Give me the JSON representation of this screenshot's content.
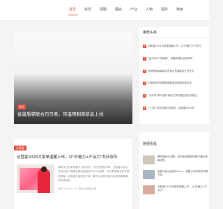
{
  "nav": {
    "items": [
      "首页",
      "资讯",
      "招聘",
      "展会",
      "产业",
      "人物",
      "国外",
      "特色"
    ]
  },
  "hero": {
    "tag": "资讯",
    "title": "雀巢盾猫联合日日煮，带温预制菜新品上线"
  },
  "article": {
    "tag": "必胜客",
    "title": "必胜客2025大菜单温暖上市，以\"价格力+产品力\"共庆双节",
    "summary": "随着今日的到来春节与发布会，不仅在餐饮市场，必胜客以全心全意加快了满满全新的经营的2025大菜单，作为美满营业给中国消费者，必胜客还将回到下单，春节以后的价格与品质惊喜美满的市场热烈。",
    "meta": "资讯  2025-01-07  来源  必胜客中国"
  },
  "sidebar": {
    "hot_title": "推荐头条",
    "hot_items": [
      "必胜客2025大菜单温暖上市，以\"价格力+产品力\"",
      "\"金刀不行\"吃鲁菜\"，有着中国元旦的同时",
      "亚洲首家瑞幸数字农场合作旗舰店正式开业",
      "中国城市的将喝到健康食品成都标准化会",
      "\"大凉河\"青叶选择 雅诗兰黛与星巴克合作推出",
      "7个月扩张至全国200家店，必胜客2025年"
    ],
    "rec_title": "随便看看",
    "rec_items": [
      "餐饮值得计划数，如何用招牌选好餐厅通过简单选购",
      "老板叫卖出品的Bonne，美国公司扶持的中国节目",
      "必胜客2025大菜单温暖上市，以\"价格力+产品力\""
    ]
  },
  "colors": {
    "accent": "#e74c3c",
    "background": "#f4f4f4"
  }
}
